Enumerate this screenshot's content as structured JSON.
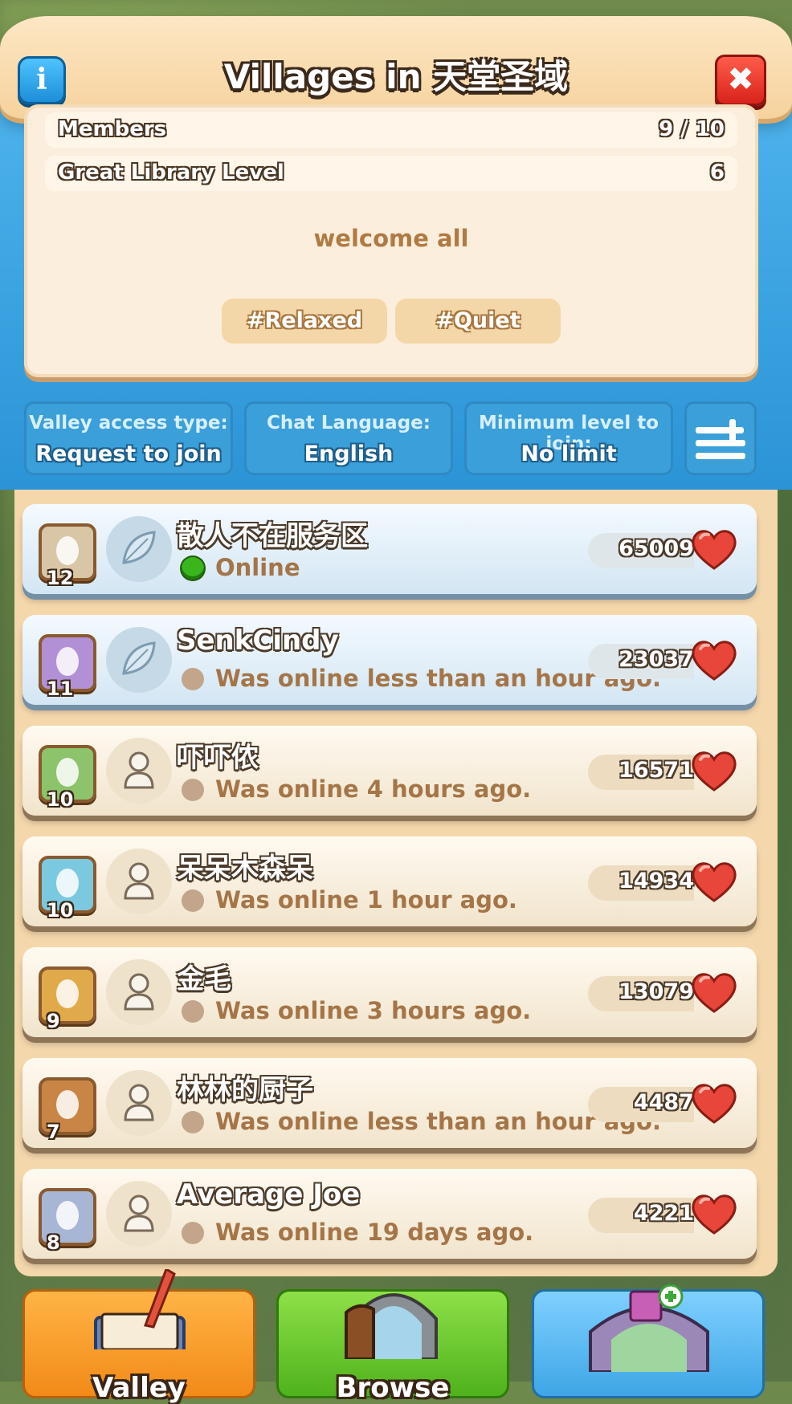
{
  "header": {
    "title": "Villages in 天堂圣域"
  },
  "info": {
    "members_label": "Members",
    "members_value": "9 / 10",
    "library_label": "Great Library Level",
    "library_value": "6",
    "description": "welcome all",
    "tags": [
      "#Relaxed",
      "#Quiet"
    ]
  },
  "settings": [
    {
      "label": "Valley access type:",
      "value": "Request to join"
    },
    {
      "label": "Chat Language:",
      "value": "English"
    },
    {
      "label": "Minimum level to join:",
      "value": "No limit"
    }
  ],
  "members": [
    {
      "name": "散人不在服务区",
      "level": "12",
      "status": "Online",
      "score": "65009",
      "online": true,
      "highlight": true,
      "badge_icon": "feather-icon",
      "avatar_icon": "leaf-icon"
    },
    {
      "name": "SenkCindy",
      "level": "11",
      "status": "Was online less than an hour ago.",
      "score": "23037",
      "online": false,
      "highlight": true,
      "badge_icon": "feather-icon",
      "avatar_icon": "leaf-icon"
    },
    {
      "name": "吓吓侬",
      "level": "10",
      "status": "Was online 4 hours ago.",
      "score": "16571",
      "online": false,
      "highlight": false,
      "badge_icon": "clover-icon",
      "avatar_icon": "person-icon"
    },
    {
      "name": "呆呆木森呆",
      "level": "10",
      "status": "Was online 1 hour ago.",
      "score": "14934",
      "online": false,
      "highlight": false,
      "badge_icon": "monkey-icon",
      "avatar_icon": "person-icon"
    },
    {
      "name": "金毛",
      "level": "9",
      "status": "Was online 3 hours ago.",
      "score": "13079",
      "online": false,
      "highlight": false,
      "badge_icon": "bird-icon",
      "avatar_icon": "person-icon"
    },
    {
      "name": "林林的厨子",
      "level": "7",
      "status": "Was online less than an hour ago.",
      "score": "4487",
      "online": false,
      "highlight": false,
      "badge_icon": "boar-icon",
      "avatar_icon": "person-icon"
    },
    {
      "name": "Average Joe",
      "level": "8",
      "status": "Was online 19 days ago.",
      "score": "4221",
      "online": false,
      "highlight": false,
      "badge_icon": "feather-icon",
      "avatar_icon": "person-icon"
    }
  ],
  "nav": {
    "valley": "Valley",
    "browse": "Browse",
    "create": ""
  },
  "colors": {
    "online": "#3bb51c",
    "offline": "#c2a58a",
    "heart": "#e8463a",
    "frame_blue": "#3a9edb"
  }
}
